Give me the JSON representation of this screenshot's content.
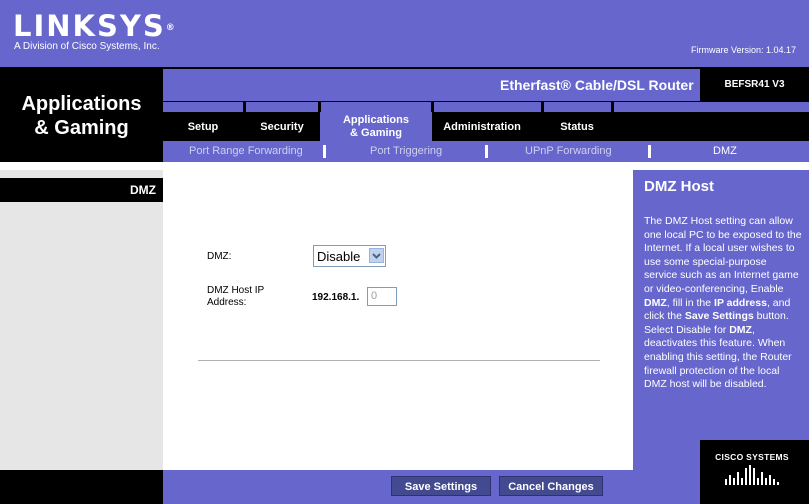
{
  "brand": {
    "logo": "LINKSYS",
    "logo_mark": "®",
    "tagline": "A Division of Cisco Systems, Inc.",
    "firmware": "Firmware Version: 1.04.17"
  },
  "header": {
    "section_title_line1": "Applications",
    "section_title_line2": "& Gaming",
    "product_name": "Etherfast® Cable/DSL Router",
    "model": "BEFSR41 V3"
  },
  "tabs": [
    {
      "label": "Setup"
    },
    {
      "label": "Security"
    },
    {
      "label_line1": "Applications",
      "label_line2": "& Gaming",
      "active": true
    },
    {
      "label": "Administration"
    },
    {
      "label": "Status"
    }
  ],
  "subtabs": [
    {
      "label": "Port Range Forwarding"
    },
    {
      "label": "Port Triggering"
    },
    {
      "label": "UPnP Forwarding"
    },
    {
      "label": "DMZ",
      "active": true
    }
  ],
  "sidebar": {
    "label": "DMZ"
  },
  "form": {
    "dmz_label": "DMZ:",
    "dmz_value": "Disable",
    "dmz_options": [
      "Disable"
    ],
    "host_ip_label_line1": "DMZ Host IP",
    "host_ip_label_line2": "Address:",
    "ip_prefix": "192.168.1.",
    "ip_last_octet": "0"
  },
  "help": {
    "title": "DMZ Host",
    "text_1": "The DMZ Host setting can allow one local PC to be exposed to the Internet. If a local user wishes to use some special-purpose service such as an Internet game or video-conferencing, Enable ",
    "bold_1": "DMZ",
    "text_2": ", fill in the ",
    "bold_2": "IP address",
    "text_3": ", and click the ",
    "bold_3": "Save Settings",
    "text_4": " button. Select Disable for ",
    "bold_4": "DMZ",
    "text_5": ", deactivates this feature. When enabling this setting, the Router firewall protection of the local DMZ host will be disabled."
  },
  "footer": {
    "save_label": "Save Settings",
    "cancel_label": "Cancel Changes",
    "cisco_label": "Cisco Systems"
  },
  "colors": {
    "brand_purple": "#6666cc",
    "button": "#434a8f"
  }
}
